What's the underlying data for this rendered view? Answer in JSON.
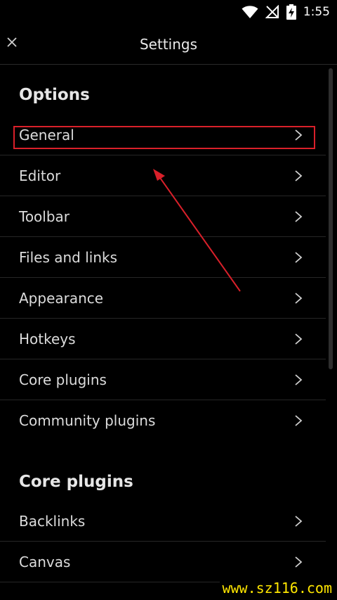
{
  "status_bar": {
    "time": "1:55",
    "icons": [
      "wifi-icon",
      "no-signal-icon",
      "battery-charging-icon"
    ]
  },
  "header": {
    "title": "Settings",
    "close_icon": "close-icon"
  },
  "sections": [
    {
      "heading": "Options",
      "items": [
        {
          "label": "General"
        },
        {
          "label": "Editor"
        },
        {
          "label": "Toolbar"
        },
        {
          "label": "Files and links"
        },
        {
          "label": "Appearance"
        },
        {
          "label": "Hotkeys"
        },
        {
          "label": "Core plugins"
        },
        {
          "label": "Community plugins"
        }
      ]
    },
    {
      "heading": "Core plugins",
      "items": [
        {
          "label": "Backlinks"
        },
        {
          "label": "Canvas"
        }
      ]
    }
  ],
  "annotation": {
    "highlight_color": "#d9202a",
    "highlighted_item": "General"
  },
  "watermark": "www.sz116.com"
}
